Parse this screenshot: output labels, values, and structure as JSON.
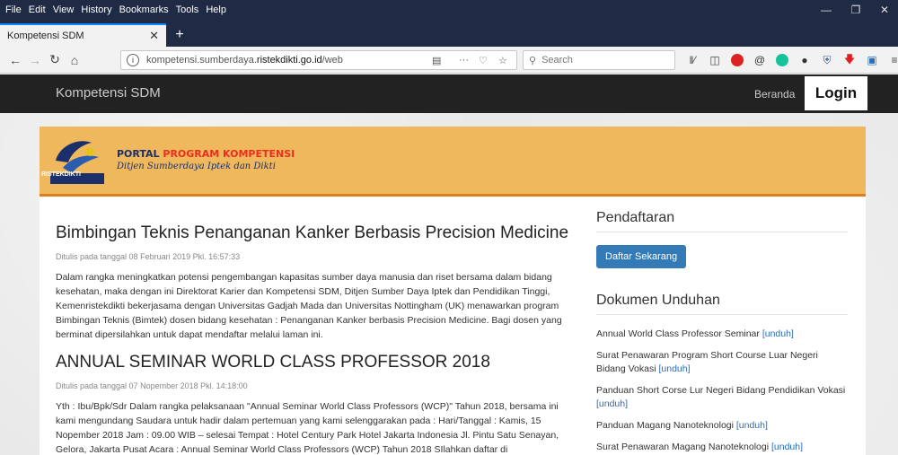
{
  "menubar": {
    "items": [
      {
        "label": "File"
      },
      {
        "label": "Edit"
      },
      {
        "label": "View"
      },
      {
        "label": "History"
      },
      {
        "label": "Bookmarks"
      },
      {
        "label": "Tools"
      },
      {
        "label": "Help"
      }
    ]
  },
  "tab": {
    "title": "Kompetensi SDM"
  },
  "nav": {
    "url_prefix": "kompetensi.sumberdaya.",
    "url_domain": "ristekdikti.go.id",
    "url_suffix": "/web",
    "search_placeholder": "Search"
  },
  "site": {
    "brand": "Kompetensi SDM",
    "nav_home": "Beranda",
    "nav_login": "Login"
  },
  "banner": {
    "title_part1": "PORTAL ",
    "title_part2": "PROGRAM KOMPETENSI",
    "subtitle": "Ditjen Sumberdaya Iptek dan Dikti",
    "logo_text": "RISTEKDIKTI"
  },
  "articles": [
    {
      "title": "Bimbingan Teknis Penanganan Kanker Berbasis Precision Medicine",
      "date": "Ditulis pada tanggal 08 Februari 2019 Pkl. 16:57:33",
      "body": "Dalam rangka meningkatkan potensi pengembangan kapasitas sumber daya manusia dan riset bersama dalam bidang kesehatan, maka dengan ini Direktorat Karier dan Kompetensi SDM, Ditjen Sumber Daya Iptek dan Pendidikan Tinggi, Kemenristekdikti bekerjasama dengan Universitas Gadjah Mada dan Universitas Nottingham (UK) menawarkan program Bimbingan Teknis (Bimtek) dosen bidang kesehatan : Penanganan Kanker berbasis Precision Medicine. Bagi dosen yang berminat dipersilahkan untuk dapat mendaftar melalui laman ini."
    },
    {
      "title": "ANNUAL SEMINAR WORLD CLASS PROFESSOR 2018",
      "date": "Ditulis pada tanggal 07 Nopember 2018 Pkl. 14:18:00",
      "body": "Yth : Ibu/Bpk/Sdr Dalam rangka pelaksanaan \"Annual Seminar World Class Professors (WCP)\" Tahun 2018, bersama ini kami mengundang Saudara untuk hadir dalam pertemuan yang kami selenggarakan pada : Hari/Tanggal : Kamis, 15 Nopember 2018 Jam : 09.00 WIB – selesai Tempat : Hotel Century Park Hotel Jakarta Indonesia Jl. Pintu Satu Senayan, Gelora, Jakarta Pusat Acara : Annual Seminar World Class Professors (WCP) Tahun 2018 SIlahkan daftar di"
    }
  ],
  "sidebar": {
    "pendaftaran_heading": "Pendaftaran",
    "register_button": "Daftar Sekarang",
    "dokumen_heading": "Dokumen Unduhan",
    "download_label": "[unduh]",
    "documents": [
      {
        "title": "Annual World Class Professor Seminar"
      },
      {
        "title": "Surat Penawaran Program Short Course Luar Negeri Bidang Vokasi"
      },
      {
        "title": "Panduan Short Corse Lur Negeri Bidang Pendidikan Vokasi"
      },
      {
        "title": "Panduan Magang Nanoteknologi"
      },
      {
        "title": "Surat Penawaran Magang Nanoteknologi"
      }
    ]
  },
  "colors": {
    "banner_bg": "#f0b85c",
    "banner_border": "#e07c1c",
    "button_blue": "#337ab7",
    "link_blue": "#2a6ebb"
  }
}
